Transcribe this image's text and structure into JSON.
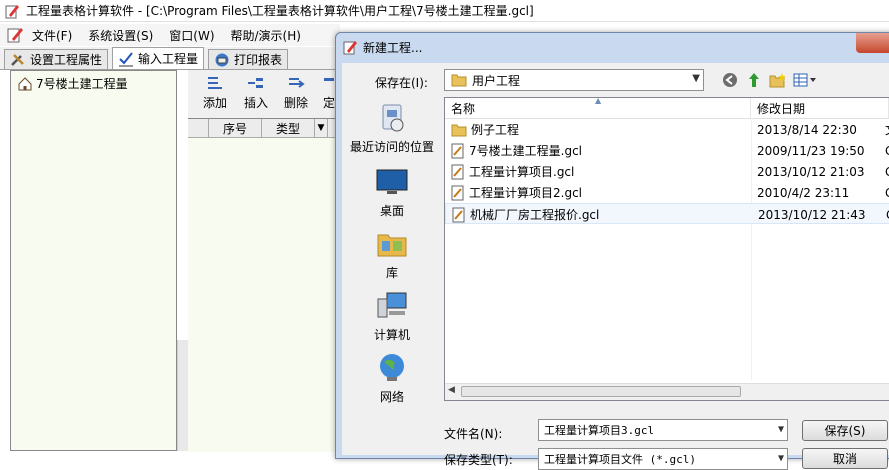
{
  "main_window": {
    "title": "工程量表格计算软件 - [C:\\Program Files\\工程量表格计算软件\\用户工程\\7号楼土建工程量.gcl]",
    "menu": [
      "文件(F)",
      "系统设置(S)",
      "窗口(W)",
      "帮助/演示(H)"
    ],
    "tabs": [
      "设置工程属性",
      "输入工程量",
      "打印报表"
    ],
    "tree_items": [
      "7号楼土建工程量"
    ],
    "toolbar": [
      "添加",
      "插入",
      "删除",
      "定"
    ],
    "grid_headers": [
      "序号",
      "类型"
    ]
  },
  "dialog": {
    "title": "新建工程...",
    "save_in_label": "保存在(I):",
    "save_in_value": "用户工程",
    "places": [
      "最近访问的位置",
      "桌面",
      "库",
      "计算机",
      "网络"
    ],
    "columns": {
      "name": "名称",
      "date": "修改日期"
    },
    "files": [
      {
        "name": "例子工程",
        "date": "2013/8/14 22:30",
        "extra": "文",
        "type": "folder"
      },
      {
        "name": "7号楼土建工程量.gcl",
        "date": "2009/11/23 19:50",
        "extra": "G",
        "type": "file"
      },
      {
        "name": "工程量计算项目.gcl",
        "date": "2013/10/12 21:03",
        "extra": "G",
        "type": "file"
      },
      {
        "name": "工程量计算项目2.gcl",
        "date": "2010/4/2 23:11",
        "extra": "G",
        "type": "file"
      },
      {
        "name": "机械厂厂房工程报价.gcl",
        "date": "2013/10/12 21:43",
        "extra": "G",
        "type": "file"
      }
    ],
    "file_name_label": "文件名(N):",
    "file_name_value": "工程量计算项目3.gcl",
    "file_type_label": "保存类型(T):",
    "file_type_value": "工程量计算项目文件 (*.gcl)",
    "save_button": "保存(S)",
    "cancel_button": "取消"
  }
}
